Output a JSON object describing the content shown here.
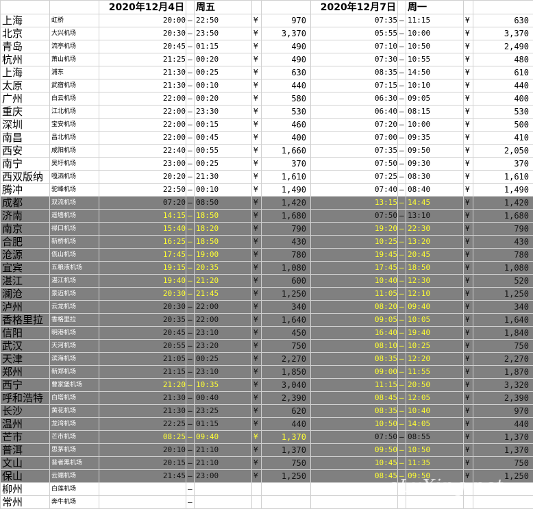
{
  "header": {
    "date1": "2020年12月4日",
    "day1": "周五",
    "date2": "2020年12月7日",
    "day2": "周一"
  },
  "dash": "–",
  "yen": "¥",
  "watermark": "eLvXing.net",
  "colors": {
    "grey_band": "#808080",
    "highlight": "#ffff33"
  },
  "rows": [
    {
      "city": "上海",
      "airport": "虹桥",
      "d1": "20:00",
      "a1": "22:50",
      "yen1": "¥",
      "p1": "970",
      "d2": "07:35",
      "a2": "11:15",
      "yen2": "¥",
      "p2": "630",
      "shaded": false,
      "hl1": false,
      "hlp1": false,
      "hl2": false
    },
    {
      "city": "北京",
      "airport": "大兴机场",
      "d1": "20:30",
      "a1": "23:50",
      "yen1": "¥",
      "p1": "3,370",
      "d2": "05:55",
      "a2": "10:00",
      "yen2": "¥",
      "p2": "3,370",
      "shaded": false,
      "hl1": false,
      "hlp1": false,
      "hl2": false
    },
    {
      "city": "青岛",
      "airport": "流亭机场",
      "d1": "20:45",
      "a1": "01:15",
      "yen1": "¥",
      "p1": "490",
      "d2": "07:10",
      "a2": "10:50",
      "yen2": "¥",
      "p2": "2,490",
      "shaded": false,
      "hl1": false,
      "hlp1": false,
      "hl2": false
    },
    {
      "city": "杭州",
      "airport": "萧山机场",
      "d1": "21:25",
      "a1": "00:20",
      "yen1": "¥",
      "p1": "490",
      "d2": "07:30",
      "a2": "10:55",
      "yen2": "¥",
      "p2": "480",
      "shaded": false,
      "hl1": false,
      "hlp1": false,
      "hl2": false
    },
    {
      "city": "上海",
      "airport": "浦东",
      "d1": "21:30",
      "a1": "00:25",
      "yen1": "¥",
      "p1": "630",
      "d2": "08:35",
      "a2": "14:50",
      "yen2": "¥",
      "p2": "610",
      "shaded": false,
      "hl1": false,
      "hlp1": false,
      "hl2": false
    },
    {
      "city": "太原",
      "airport": "武宿机场",
      "d1": "21:30",
      "a1": "00:10",
      "yen1": "¥",
      "p1": "440",
      "d2": "07:15",
      "a2": "10:10",
      "yen2": "¥",
      "p2": "440",
      "shaded": false,
      "hl1": false,
      "hlp1": false,
      "hl2": false
    },
    {
      "city": "广州",
      "airport": "白云机场",
      "d1": "22:00",
      "a1": "00:20",
      "yen1": "¥",
      "p1": "580",
      "d2": "06:30",
      "a2": "09:05",
      "yen2": "¥",
      "p2": "400",
      "shaded": false,
      "hl1": false,
      "hlp1": false,
      "hl2": false
    },
    {
      "city": "重庆",
      "airport": "江北机场",
      "d1": "22:00",
      "a1": "23:30",
      "yen1": "¥",
      "p1": "530",
      "d2": "06:40",
      "a2": "08:15",
      "yen2": "¥",
      "p2": "530",
      "shaded": false,
      "hl1": false,
      "hlp1": false,
      "hl2": false
    },
    {
      "city": "深圳",
      "airport": "宝安机场",
      "d1": "22:00",
      "a1": "00:15",
      "yen1": "¥",
      "p1": "460",
      "d2": "07:20",
      "a2": "10:00",
      "yen2": "¥",
      "p2": "500",
      "shaded": false,
      "hl1": false,
      "hlp1": false,
      "hl2": false
    },
    {
      "city": "南昌",
      "airport": "昌北机场",
      "d1": "22:00",
      "a1": "00:45",
      "yen1": "¥",
      "p1": "400",
      "d2": "07:00",
      "a2": "09:35",
      "yen2": "¥",
      "p2": "410",
      "shaded": false,
      "hl1": false,
      "hlp1": false,
      "hl2": false
    },
    {
      "city": "西安",
      "airport": "咸阳机场",
      "d1": "22:40",
      "a1": "00:55",
      "yen1": "¥",
      "p1": "1,660",
      "d2": "07:35",
      "a2": "09:50",
      "yen2": "¥",
      "p2": "2,050",
      "shaded": false,
      "hl1": false,
      "hlp1": false,
      "hl2": false
    },
    {
      "city": "南宁",
      "airport": "吴圩机场",
      "d1": "23:00",
      "a1": "00:25",
      "yen1": "¥",
      "p1": "370",
      "d2": "07:50",
      "a2": "09:30",
      "yen2": "¥",
      "p2": "370",
      "shaded": false,
      "hl1": false,
      "hlp1": false,
      "hl2": false
    },
    {
      "city": "西双版纳",
      "airport": "嘎洒机场",
      "d1": "20:20",
      "a1": "21:30",
      "yen1": "¥",
      "p1": "1,610",
      "d2": "07:25",
      "a2": "08:30",
      "yen2": "¥",
      "p2": "1,610",
      "shaded": false,
      "hl1": false,
      "hlp1": false,
      "hl2": false
    },
    {
      "city": "腾冲",
      "airport": "驼峰机场",
      "d1": "22:50",
      "a1": "00:10",
      "yen1": "¥",
      "p1": "1,490",
      "d2": "07:40",
      "a2": "08:40",
      "yen2": "¥",
      "p2": "1,490",
      "shaded": false,
      "hl1": false,
      "hlp1": false,
      "hl2": false
    },
    {
      "city": "成都",
      "airport": "双流机场",
      "d1": "07:20",
      "a1": "08:50",
      "yen1": "¥",
      "p1": "1,420",
      "d2": "13:15",
      "a2": "14:45",
      "yen2": "¥",
      "p2": "1,420",
      "shaded": true,
      "hl1": false,
      "hlp1": false,
      "hl2": true
    },
    {
      "city": "济南",
      "airport": "遥墙机场",
      "d1": "14:15",
      "a1": "18:50",
      "yen1": "¥",
      "p1": "1,680",
      "d2": "07:50",
      "a2": "13:10",
      "yen2": "¥",
      "p2": "1,680",
      "shaded": true,
      "hl1": true,
      "hlp1": false,
      "hl2": false
    },
    {
      "city": "南京",
      "airport": "禄口机场",
      "d1": "15:40",
      "a1": "18:20",
      "yen1": "¥",
      "p1": "790",
      "d2": "19:20",
      "a2": "22:30",
      "yen2": "¥",
      "p2": "790",
      "shaded": true,
      "hl1": true,
      "hlp1": false,
      "hl2": true
    },
    {
      "city": "合肥",
      "airport": "新桥机场",
      "d1": "16:25",
      "a1": "18:50",
      "yen1": "¥",
      "p1": "430",
      "d2": "10:25",
      "a2": "13:20",
      "yen2": "¥",
      "p2": "430",
      "shaded": true,
      "hl1": true,
      "hlp1": false,
      "hl2": true
    },
    {
      "city": "沧源",
      "airport": "佤山机场",
      "d1": "17:45",
      "a1": "19:00",
      "yen1": "¥",
      "p1": "780",
      "d2": "19:45",
      "a2": "20:45",
      "yen2": "¥",
      "p2": "780",
      "shaded": true,
      "hl1": true,
      "hlp1": false,
      "hl2": true
    },
    {
      "city": "宜宾",
      "airport": "五粮液机场",
      "d1": "19:15",
      "a1": "20:35",
      "yen1": "¥",
      "p1": "1,080",
      "d2": "17:45",
      "a2": "18:50",
      "yen2": "¥",
      "p2": "1,080",
      "shaded": true,
      "hl1": true,
      "hlp1": false,
      "hl2": true
    },
    {
      "city": "湛江",
      "airport": "湛江机场",
      "d1": "19:40",
      "a1": "21:20",
      "yen1": "¥",
      "p1": "600",
      "d2": "10:40",
      "a2": "12:30",
      "yen2": "¥",
      "p2": "520",
      "shaded": true,
      "hl1": true,
      "hlp1": false,
      "hl2": true
    },
    {
      "city": "澜沧",
      "airport": "景迈机场",
      "d1": "20:30",
      "a1": "21:45",
      "yen1": "¥",
      "p1": "1,250",
      "d2": "11:05",
      "a2": "12:10",
      "yen2": "¥",
      "p2": "1,250",
      "shaded": true,
      "hl1": true,
      "hlp1": false,
      "hl2": true
    },
    {
      "city": "泸州",
      "airport": "云龙机场",
      "d1": "20:30",
      "a1": "22:00",
      "yen1": "¥",
      "p1": "340",
      "d2": "08:20",
      "a2": "09:40",
      "yen2": "¥",
      "p2": "340",
      "shaded": true,
      "hl1": false,
      "hlp1": false,
      "hl2": true
    },
    {
      "city": "香格里拉",
      "airport": "香格里拉",
      "d1": "20:35",
      "a1": "22:00",
      "yen1": "¥",
      "p1": "1,640",
      "d2": "09:05",
      "a2": "10:05",
      "yen2": "¥",
      "p2": "1,640",
      "shaded": true,
      "hl1": false,
      "hlp1": false,
      "hl2": true
    },
    {
      "city": "信阳",
      "airport": "明港机场",
      "d1": "20:45",
      "a1": "23:10",
      "yen1": "¥",
      "p1": "450",
      "d2": "16:40",
      "a2": "19:40",
      "yen2": "¥",
      "p2": "1,840",
      "shaded": true,
      "hl1": false,
      "hlp1": false,
      "hl2": true
    },
    {
      "city": "武汉",
      "airport": "天河机场",
      "d1": "20:55",
      "a1": "23:20",
      "yen1": "¥",
      "p1": "750",
      "d2": "08:10",
      "a2": "10:25",
      "yen2": "¥",
      "p2": "750",
      "shaded": true,
      "hl1": false,
      "hlp1": false,
      "hl2": true
    },
    {
      "city": "天津",
      "airport": "滨海机场",
      "d1": "21:05",
      "a1": "00:25",
      "yen1": "¥",
      "p1": "2,270",
      "d2": "08:35",
      "a2": "12:20",
      "yen2": "¥",
      "p2": "2,270",
      "shaded": true,
      "hl1": false,
      "hlp1": false,
      "hl2": true
    },
    {
      "city": "郑州",
      "airport": "新郑机场",
      "d1": "21:15",
      "a1": "23:10",
      "yen1": "¥",
      "p1": "1,850",
      "d2": "09:00",
      "a2": "11:55",
      "yen2": "¥",
      "p2": "1,870",
      "shaded": true,
      "hl1": false,
      "hlp1": false,
      "hl2": true
    },
    {
      "city": "西宁",
      "airport": "曹家堡机场",
      "d1": "21:20",
      "a1": "10:35",
      "yen1": "¥",
      "p1": "3,040",
      "d2": "11:15",
      "a2": "20:50",
      "yen2": "¥",
      "p2": "3,320",
      "shaded": true,
      "hl1": true,
      "hlp1": false,
      "hl2": true
    },
    {
      "city": "呼和浩特",
      "airport": "白塔机场",
      "d1": "21:30",
      "a1": "00:40",
      "yen1": "¥",
      "p1": "2,390",
      "d2": "08:45",
      "a2": "12:05",
      "yen2": "¥",
      "p2": "2,390",
      "shaded": true,
      "hl1": false,
      "hlp1": false,
      "hl2": true
    },
    {
      "city": "长沙",
      "airport": "黄花机场",
      "d1": "21:30",
      "a1": "23:25",
      "yen1": "¥",
      "p1": "620",
      "d2": "08:35",
      "a2": "10:40",
      "yen2": "¥",
      "p2": "970",
      "shaded": true,
      "hl1": false,
      "hlp1": false,
      "hl2": true
    },
    {
      "city": "温州",
      "airport": "龙湾机场",
      "d1": "22:25",
      "a1": "01:15",
      "yen1": "¥",
      "p1": "440",
      "d2": "10:50",
      "a2": "14:05",
      "yen2": "¥",
      "p2": "440",
      "shaded": true,
      "hl1": false,
      "hlp1": false,
      "hl2": true
    },
    {
      "city": "芒市",
      "airport": "芒市机场",
      "d1": "08:25",
      "a1": "09:40",
      "yen1": "¥",
      "p1": "1,370",
      "d2": "07:50",
      "a2": "08:55",
      "yen2": "¥",
      "p2": "1,370",
      "shaded": true,
      "hl1": true,
      "hlp1": true,
      "hl2": false
    },
    {
      "city": "普洱",
      "airport": "思茅机场",
      "d1": "20:10",
      "a1": "21:10",
      "yen1": "¥",
      "p1": "1,370",
      "d2": "09:50",
      "a2": "10:50",
      "yen2": "¥",
      "p2": "1,370",
      "shaded": true,
      "hl1": false,
      "hlp1": false,
      "hl2": true
    },
    {
      "city": "文山",
      "airport": "普者黑机场",
      "d1": "20:15",
      "a1": "21:10",
      "yen1": "¥",
      "p1": "750",
      "d2": "10:45",
      "a2": "11:35",
      "yen2": "¥",
      "p2": "750",
      "shaded": true,
      "hl1": false,
      "hlp1": false,
      "hl2": true
    },
    {
      "city": "保山",
      "airport": "云端机场",
      "d1": "21:45",
      "a1": "23:00",
      "yen1": "¥",
      "p1": "1,250",
      "d2": "08:45",
      "a2": "09:50",
      "yen2": "¥",
      "p2": "1,250",
      "shaded": true,
      "hl1": false,
      "hlp1": false,
      "hl2": true
    },
    {
      "city": "柳州",
      "airport": "白莲机场",
      "d1": "",
      "a1": "",
      "yen1": "",
      "p1": "",
      "d2": "",
      "a2": "",
      "yen2": "",
      "p2": "",
      "shaded": false,
      "hl1": false,
      "hlp1": false,
      "hl2": false
    },
    {
      "city": "常州",
      "airport": "奔牛机场",
      "d1": "",
      "a1": "",
      "yen1": "",
      "p1": "",
      "d2": "",
      "a2": "",
      "yen2": "",
      "p2": "",
      "shaded": false,
      "hl1": false,
      "hlp1": false,
      "hl2": false
    }
  ]
}
